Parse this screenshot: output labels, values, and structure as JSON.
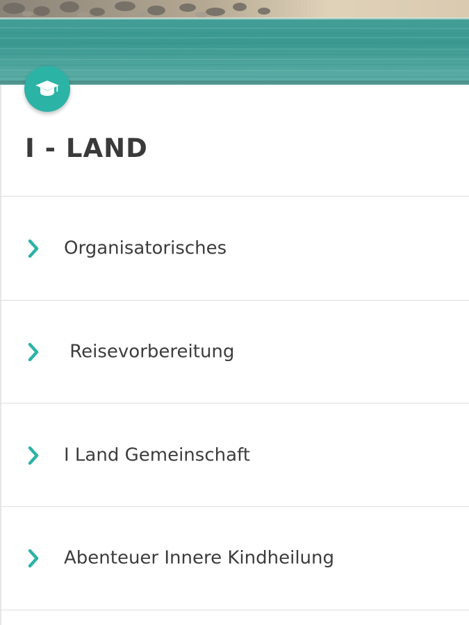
{
  "header": {
    "badge_icon": "graduation-cap-icon",
    "accent_color": "#2bb3a6"
  },
  "title": "I - LAND",
  "menu": {
    "items": [
      {
        "label": "Organisatorisches",
        "icon": "chevron-right-icon"
      },
      {
        "label": " Reisevorbereitung",
        "icon": "chevron-right-icon"
      },
      {
        "label": "I Land Gemeinschaft",
        "icon": "chevron-right-icon"
      },
      {
        "label": "Abenteuer Innere Kindheilung",
        "icon": "chevron-right-icon"
      }
    ]
  }
}
